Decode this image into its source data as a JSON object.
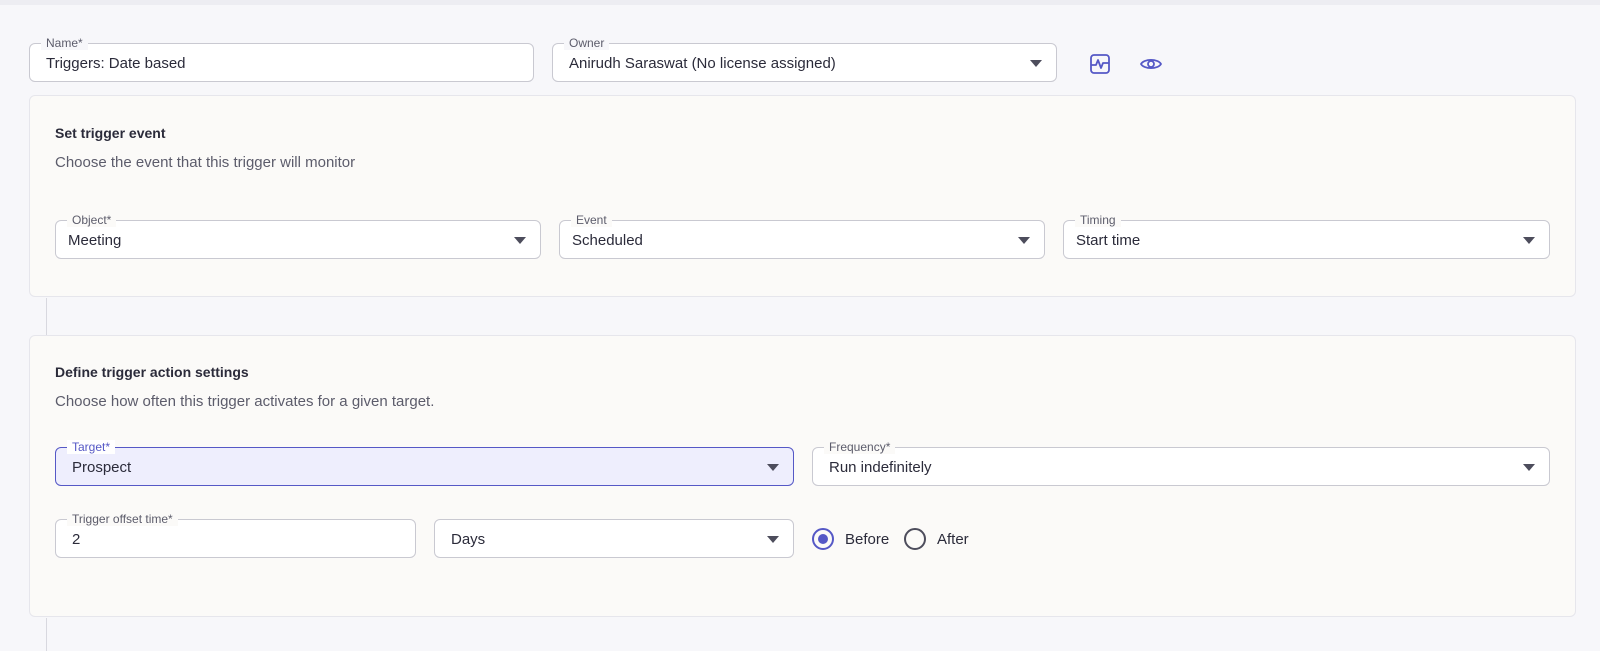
{
  "header": {
    "name_field": {
      "label": "Name*",
      "value": "Triggers: Date based"
    },
    "owner_field": {
      "label": "Owner",
      "value": "Anirudh Saraswat (No license assigned)"
    },
    "icons": [
      "activity-icon",
      "eye-icon"
    ]
  },
  "trigger_event": {
    "title": "Set trigger event",
    "description": "Choose the event that this trigger will monitor",
    "object": {
      "label": "Object*",
      "value": "Meeting"
    },
    "event": {
      "label": "Event",
      "value": "Scheduled"
    },
    "timing": {
      "label": "Timing",
      "value": "Start time"
    }
  },
  "trigger_action": {
    "title": "Define trigger action settings",
    "description": "Choose how often this trigger activates for a given target.",
    "target": {
      "label": "Target*",
      "value": "Prospect"
    },
    "frequency": {
      "label": "Frequency*",
      "value": "Run indefinitely"
    },
    "offset": {
      "label": "Trigger offset time*",
      "value": "2"
    },
    "unit": {
      "value": "Days"
    },
    "radios": {
      "before": "Before",
      "after": "After",
      "selected": "Before"
    }
  },
  "colors": {
    "accent": "#5558c6",
    "card": "#fbfaf8",
    "background": "#f7f7fa"
  }
}
